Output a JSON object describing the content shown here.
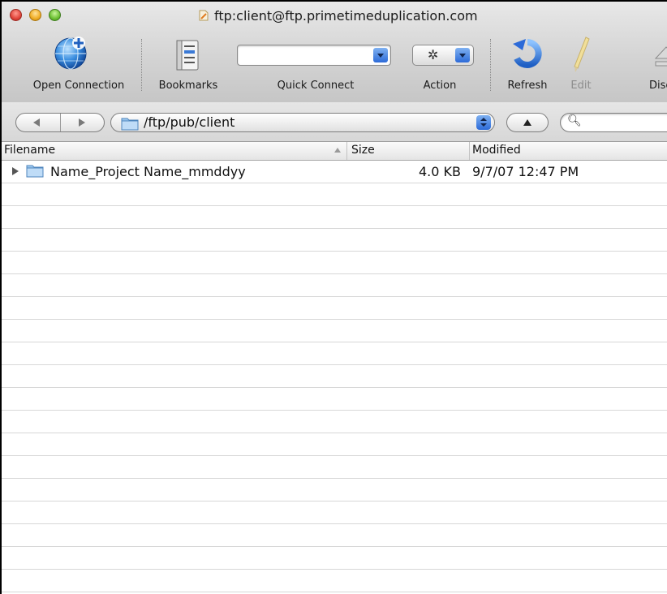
{
  "window": {
    "title": "ftp:client@ftp.primetimeduplication.com"
  },
  "toolbar": {
    "open_connection": "Open Connection",
    "bookmarks": "Bookmarks",
    "quick_connect": "Quick Connect",
    "quick_connect_value": "",
    "action": "Action",
    "refresh": "Refresh",
    "edit": "Edit",
    "disconnect": "Disco"
  },
  "pathbar": {
    "path": "/ftp/pub/client",
    "search_value": ""
  },
  "table": {
    "columns": [
      "Filename",
      "Size",
      "Modified"
    ],
    "sort_column": "Filename",
    "sort_direction": "ascending",
    "rows": [
      {
        "filename": "Name_Project Name_mmddyy",
        "size": "4.0 KB",
        "modified": "9/7/07 12:47 PM",
        "kind": "folder"
      }
    ]
  },
  "colors": {
    "accent_blue": "#2c6ad8",
    "row_separator": "#d7d7d7"
  }
}
